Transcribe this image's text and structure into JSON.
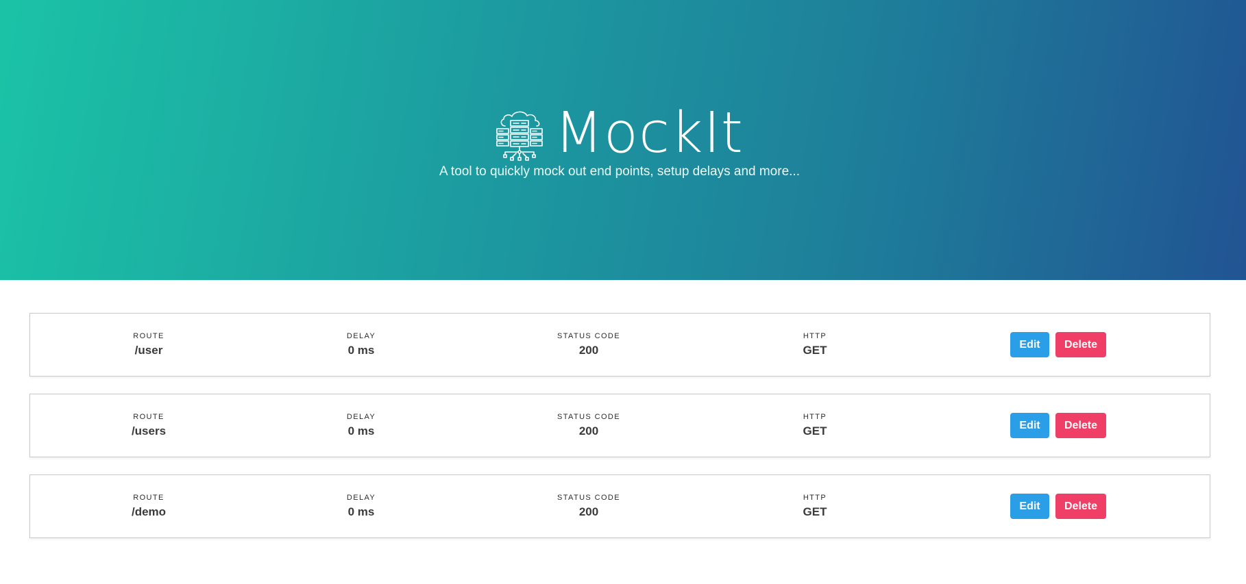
{
  "header": {
    "title": "MockIt",
    "tagline": "A tool to quickly mock out end points, setup delays and more...",
    "logo_icon": "cloud-server-network-icon"
  },
  "labels": {
    "route": "ROUTE",
    "delay": "DELAY",
    "status_code": "STATUS CODE",
    "http": "HTTP",
    "edit": "Edit",
    "delete": "Delete"
  },
  "routes": [
    {
      "route": "/user",
      "delay": "0 ms",
      "status_code": "200",
      "http": "GET"
    },
    {
      "route": "/users",
      "delay": "0 ms",
      "status_code": "200",
      "http": "GET"
    },
    {
      "route": "/demo",
      "delay": "0 ms",
      "status_code": "200",
      "http": "GET"
    }
  ],
  "colors": {
    "gradient_start": "#1bc3a6",
    "gradient_end": "#215493",
    "edit_button": "#2b9ee8",
    "delete_button": "#f03f66",
    "card_border": "#a9d3dd"
  }
}
